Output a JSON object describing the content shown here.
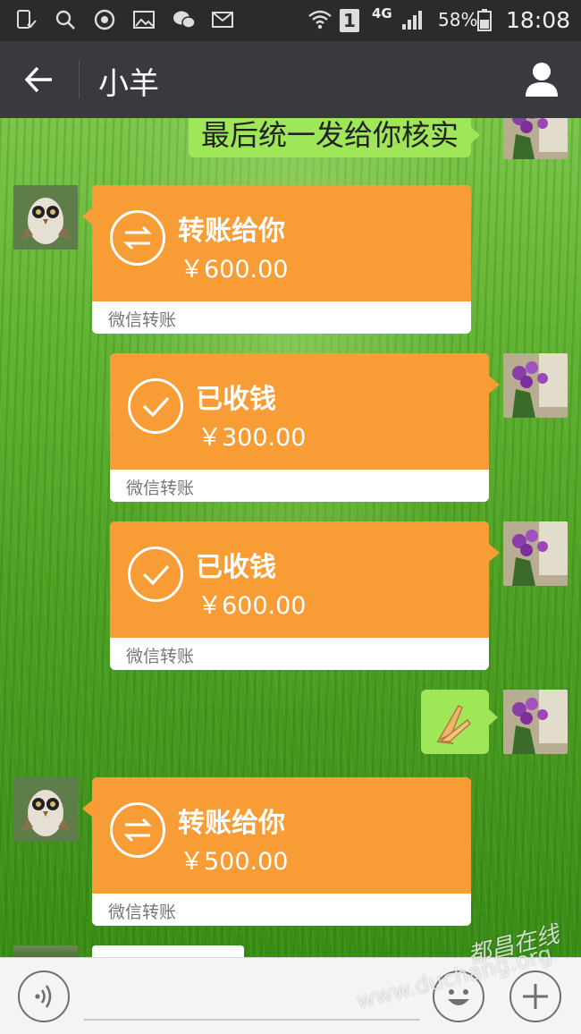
{
  "status_bar": {
    "signal_label": "1",
    "network": "4G",
    "battery": "58%",
    "time": "18:08"
  },
  "header": {
    "title": "小羊",
    "back_icon": "arrow-left-icon",
    "profile_icon": "person-icon"
  },
  "messages": [
    {
      "kind": "text",
      "side": "right",
      "text": "最后统一发给你核实"
    },
    {
      "kind": "transfer",
      "side": "left",
      "status": "转账给你",
      "amount": "￥600.00",
      "footer": "微信转账"
    },
    {
      "kind": "transfer",
      "side": "right",
      "status": "已收钱",
      "amount": "￥300.00",
      "footer": "微信转账"
    },
    {
      "kind": "transfer",
      "side": "right",
      "status": "已收钱",
      "amount": "￥600.00",
      "footer": "微信转账"
    },
    {
      "kind": "emoji",
      "side": "right",
      "emoji": "pray-hands-icon"
    },
    {
      "kind": "transfer",
      "side": "left",
      "status": "转账给你",
      "amount": "￥500.00",
      "footer": "微信转账"
    }
  ],
  "input_bar": {
    "voice_icon": "voice-icon",
    "emoji_icon": "smiley-icon",
    "plus_icon": "plus-icon"
  },
  "watermark": {
    "line1": "都昌在线",
    "line2": "www.duchang.org"
  },
  "colors": {
    "transfer_orange": "#f89c36",
    "sent_bubble": "#9fe658",
    "title_bar": "#393a3f",
    "status_bar": "#2b2b2b"
  }
}
